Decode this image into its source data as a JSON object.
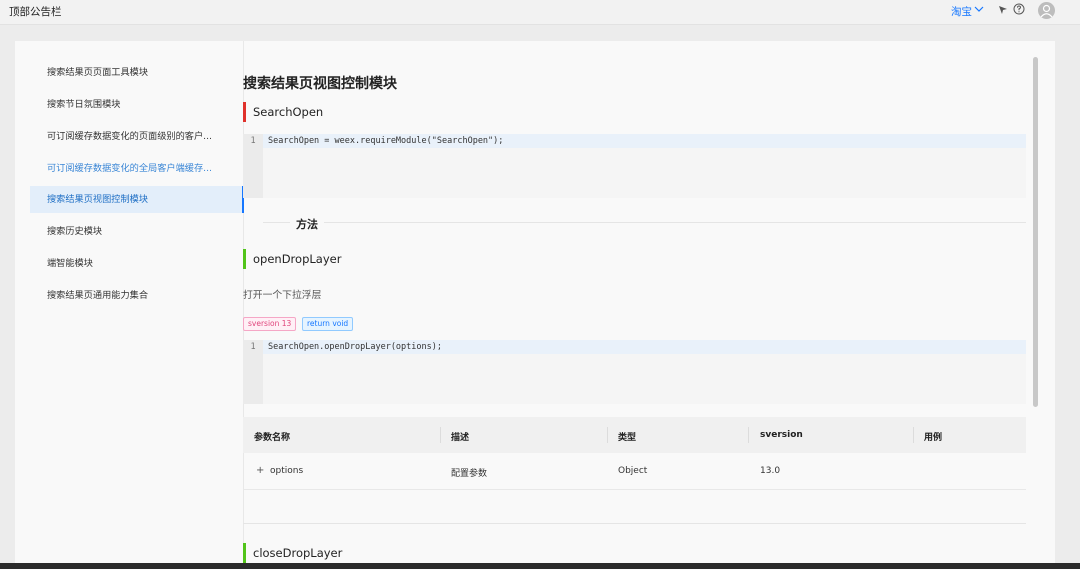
{
  "topbar": {
    "title": "顶部公告栏",
    "brand": "淘宝"
  },
  "sidebar": {
    "items": [
      {
        "label": "搜索结果页页面工具模块"
      },
      {
        "label": "搜索节日氛围模块"
      },
      {
        "label": "可订阅缓存数据变化的页面级别的客户..."
      },
      {
        "label": "可订阅缓存数据变化的全局客户端缓存..."
      },
      {
        "label": "搜索结果页视图控制模块"
      },
      {
        "label": "搜索历史模块"
      },
      {
        "label": "端智能模块"
      },
      {
        "label": "搜索结果页通用能力集合"
      }
    ],
    "active_index": 4,
    "hover_index": 3
  },
  "content": {
    "page_title": "搜索结果页视图控制模块",
    "module": {
      "name": "SearchOpen",
      "code_line_no": "1",
      "code": "SearchOpen = weex.requireModule(\"SearchOpen\");"
    },
    "methods_label": "方法",
    "method": {
      "name": "openDropLayer",
      "description": "打开一个下拉浮层",
      "tag_version": "sversion 13",
      "tag_return": "return void",
      "code_line_no": "1",
      "code": "SearchOpen.openDropLayer(options);"
    },
    "table": {
      "headers": [
        "参数名称",
        "描述",
        "类型",
        "sversion",
        "用例"
      ],
      "rows": [
        {
          "expand": "+",
          "name": "options",
          "desc": "配置参数",
          "type": "Object",
          "sversion": "13.0",
          "example": ""
        }
      ]
    },
    "next_method": {
      "name": "closeDropLayer"
    }
  },
  "colors": {
    "accent": "#1677ff",
    "module_bar": "#e0312b",
    "method_bar": "#52c41a"
  }
}
